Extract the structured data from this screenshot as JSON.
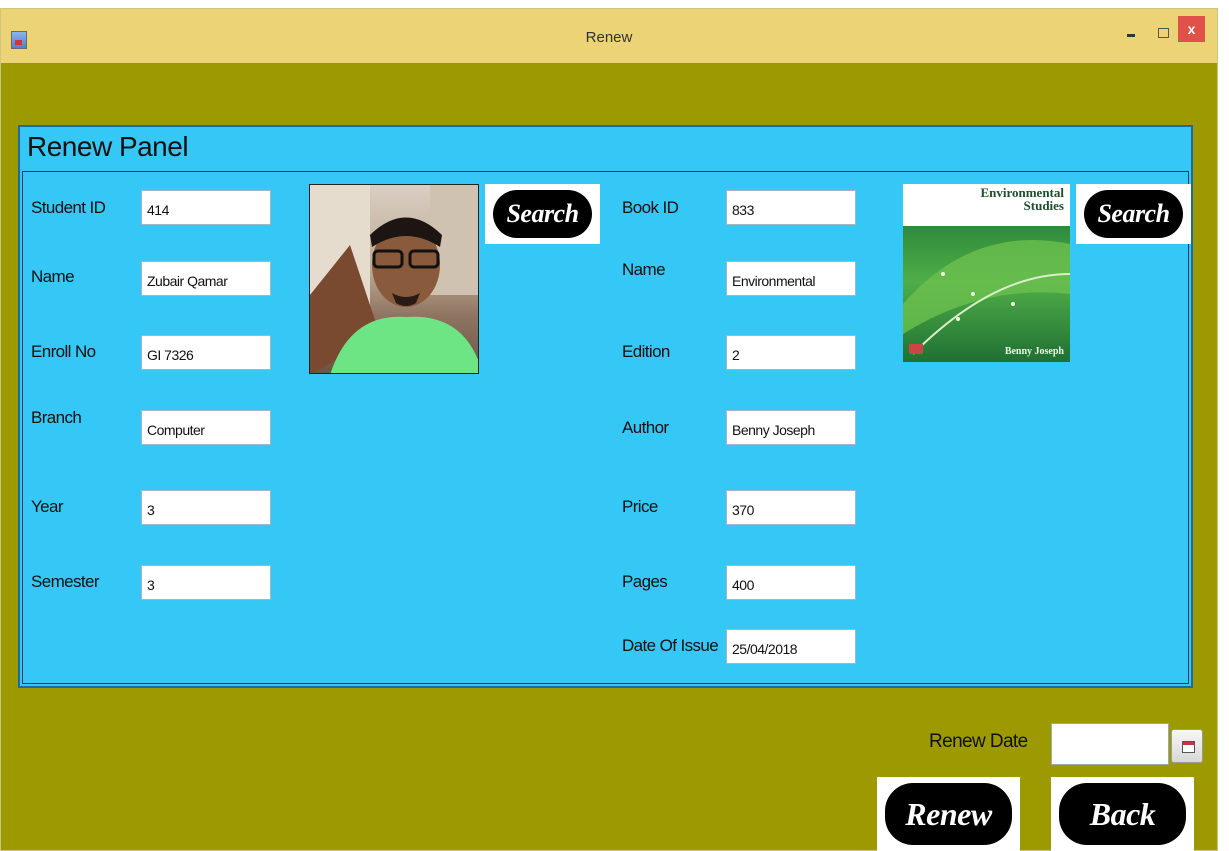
{
  "window": {
    "title": "Renew"
  },
  "panel": {
    "title": "Renew Panel"
  },
  "student": {
    "fields": [
      {
        "label": "Student ID",
        "value": "414"
      },
      {
        "label": "Name",
        "value": "Zubair Qamar"
      },
      {
        "label": "Enroll No",
        "value": "GI 7326"
      },
      {
        "label": "Branch",
        "value": "Computer"
      },
      {
        "label": "Year",
        "value": "3"
      },
      {
        "label": "Semester",
        "value": "3"
      }
    ],
    "search_label": "Search"
  },
  "book": {
    "fields": [
      {
        "label": "Book ID",
        "value": "833"
      },
      {
        "label": "Name",
        "value": "Environmental"
      },
      {
        "label": "Edition",
        "value": "2"
      },
      {
        "label": "Author",
        "value": "Benny Joseph"
      },
      {
        "label": "Price",
        "value": "370"
      },
      {
        "label": "Pages",
        "value": "400"
      },
      {
        "label": "Date Of Issue",
        "value": "25/04/2018"
      }
    ],
    "cover": {
      "title_line1": "Environmental",
      "title_line2": "Studies",
      "author": "Benny Joseph"
    },
    "search_label": "Search"
  },
  "renew": {
    "date_label": "Renew Date",
    "date_value": "",
    "renew_label": "Renew",
    "back_label": "Back"
  },
  "colors": {
    "background": "#9c9a00",
    "panel": "#35c7f6",
    "titlebar": "#ecd375",
    "close": "#e0514a"
  },
  "icons": [
    "app-icon",
    "minimize-icon",
    "maximize-icon",
    "close-icon",
    "calendar-icon"
  ]
}
